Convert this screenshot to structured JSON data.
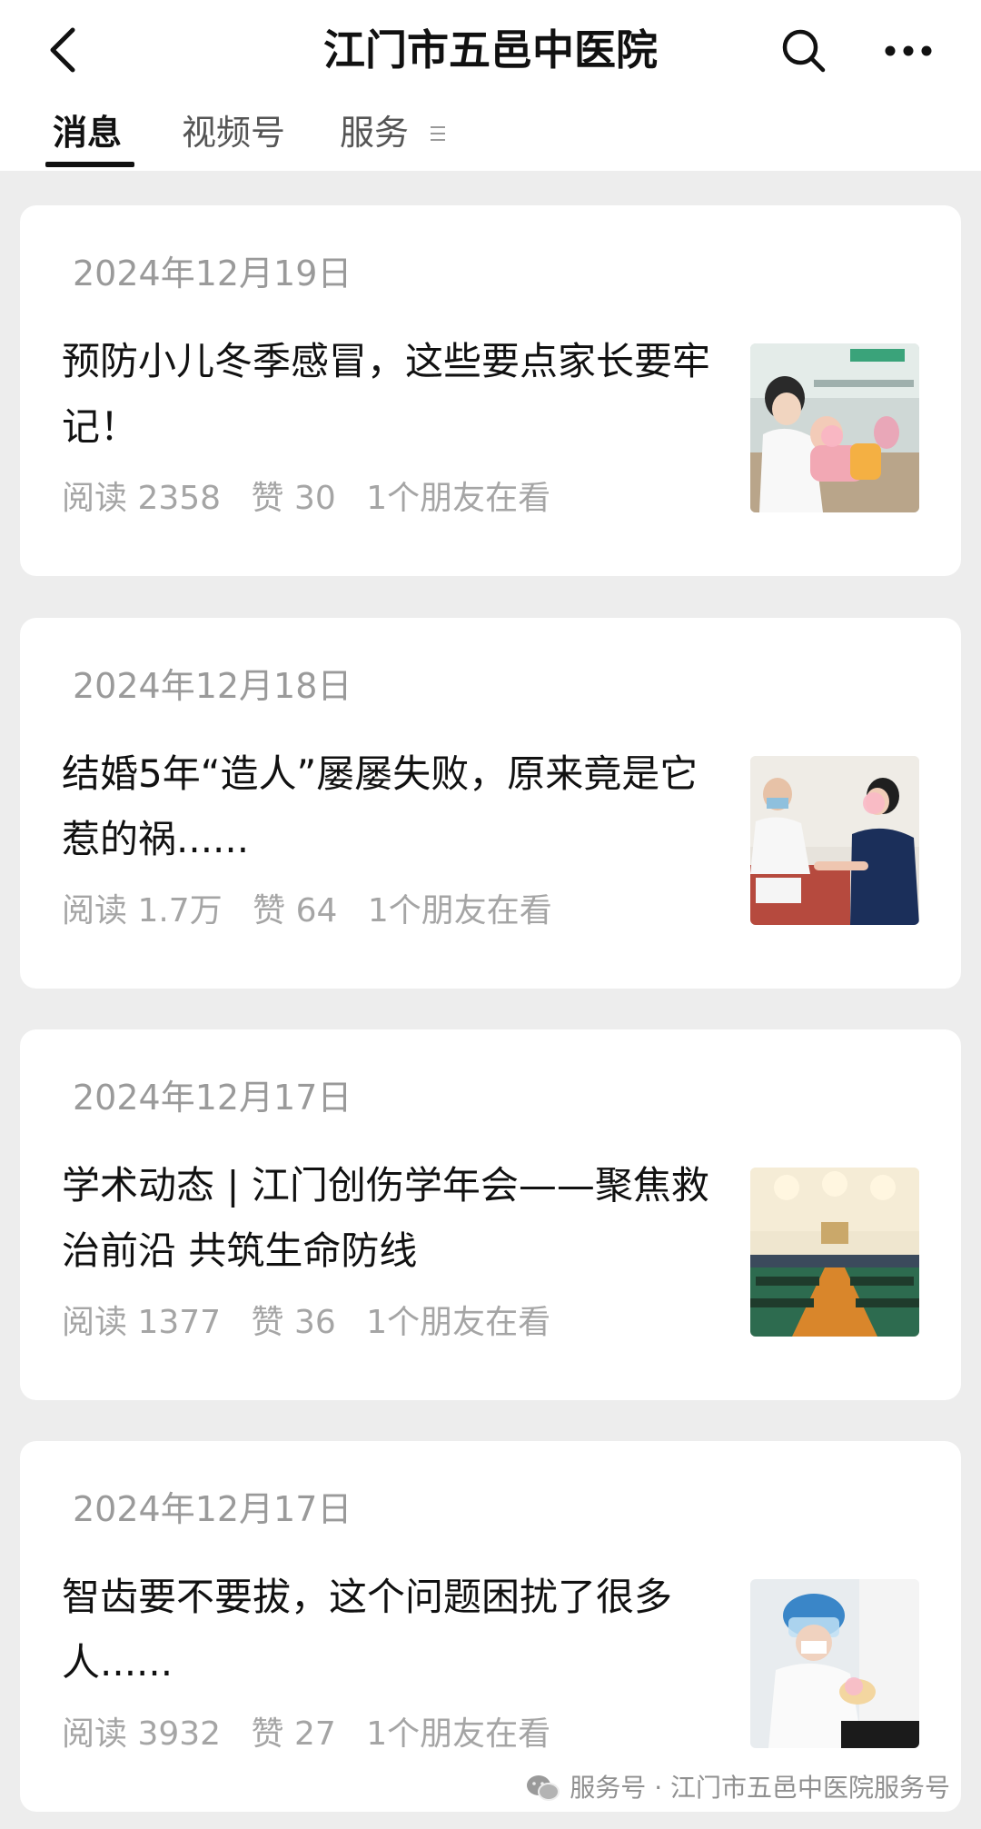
{
  "header": {
    "title": "江门市五邑中医院",
    "back_icon": "chevron-left-icon",
    "search_icon": "search-icon",
    "more_icon": "more-horizontal-icon"
  },
  "tabs": [
    {
      "label": "消息",
      "active": true
    },
    {
      "label": "视频号",
      "active": false
    },
    {
      "label": "服务",
      "active": false
    }
  ],
  "articles": [
    {
      "date": "2024年12月19日",
      "title": "预防小儿冬季感冒，这些要点家长要牢记！",
      "reads": "阅读 2358",
      "likes": "赞 30",
      "friends": "1个朋友在看",
      "thumb_icon": "doctor-child-photo"
    },
    {
      "date": "2024年12月18日",
      "title": "结婚5年“造人”屡屡失败，原来竟是它惹的祸......",
      "reads": "阅读 1.7万",
      "likes": "赞 64",
      "friends": "1个朋友在看",
      "thumb_icon": "consultation-photo"
    },
    {
      "date": "2024年12月17日",
      "title": "学术动态 | 江门创伤学年会——聚焦救治前沿 共筑生命防线",
      "reads": "阅读 1377",
      "likes": "赞 36",
      "friends": "1个朋友在看",
      "thumb_icon": "conference-hall-photo"
    },
    {
      "date": "2024年12月17日",
      "title": "智齿要不要拔，这个问题困扰了很多人......",
      "reads": "阅读 3932",
      "likes": "赞 27",
      "friends": "1个朋友在看",
      "thumb_icon": "dentist-photo"
    }
  ],
  "footer": {
    "watermark": "服务号 · 江门市五邑中医院服务号",
    "icon": "wechat-icon"
  },
  "colors": {
    "background": "#ededed",
    "card": "#ffffff",
    "meta_text": "#a5a5a5"
  }
}
